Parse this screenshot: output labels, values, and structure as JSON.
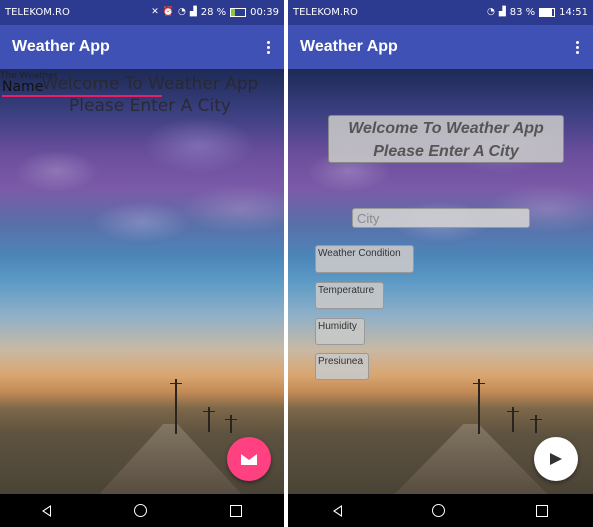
{
  "left": {
    "status": {
      "carrier": "TELEKOM.RO",
      "battery": "28 %",
      "battery_level": 0.28,
      "time": "00:39"
    },
    "app_title": "Weather App",
    "name_hint": "The Weather",
    "name_value": "Name",
    "welcome_line1": "Welcome To Weather App",
    "welcome_line2": "Please Enter A City",
    "fab_icon": "email-icon",
    "fab_color": "#ff4081"
  },
  "right": {
    "status": {
      "carrier": "TELEKOM.RO",
      "battery": "83 %",
      "battery_level": 0.83,
      "time": "14:51"
    },
    "app_title": "Weather App",
    "welcome_line1": "Welcome To Weather App",
    "welcome_line2": "Please Enter A City",
    "city_placeholder": "City",
    "fields": [
      "Weather Condition",
      "Temperature",
      "Humidity",
      "Presiunea"
    ],
    "fab_icon": "send-icon"
  },
  "colors": {
    "status_bar": "#2c3a8f",
    "app_bar": "#3f51b5",
    "accent": "#e91e63"
  }
}
